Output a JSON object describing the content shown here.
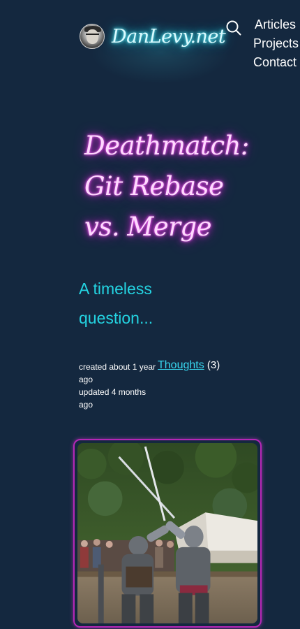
{
  "site": {
    "name": "DanLevy.net"
  },
  "nav": {
    "items": [
      "Articles",
      "Projects",
      "Contact"
    ]
  },
  "post": {
    "title_lines": [
      "Deathmatch:",
      "Git Rebase",
      "vs. Merge"
    ],
    "subtitle": "A timeless question...",
    "created": "created about 1 year ago",
    "updated": "updated 4 months ago",
    "category": "Thoughts",
    "category_count": "(3)"
  },
  "icons": {
    "search": "search-icon",
    "avatar": "avatar"
  },
  "colors": {
    "background": "#14283f",
    "brand_glow": "#20d3e6",
    "title_glow": "#e22ae2",
    "subtitle": "#24d4e2",
    "link": "#38d7f0",
    "image_border": "#b527b6"
  }
}
